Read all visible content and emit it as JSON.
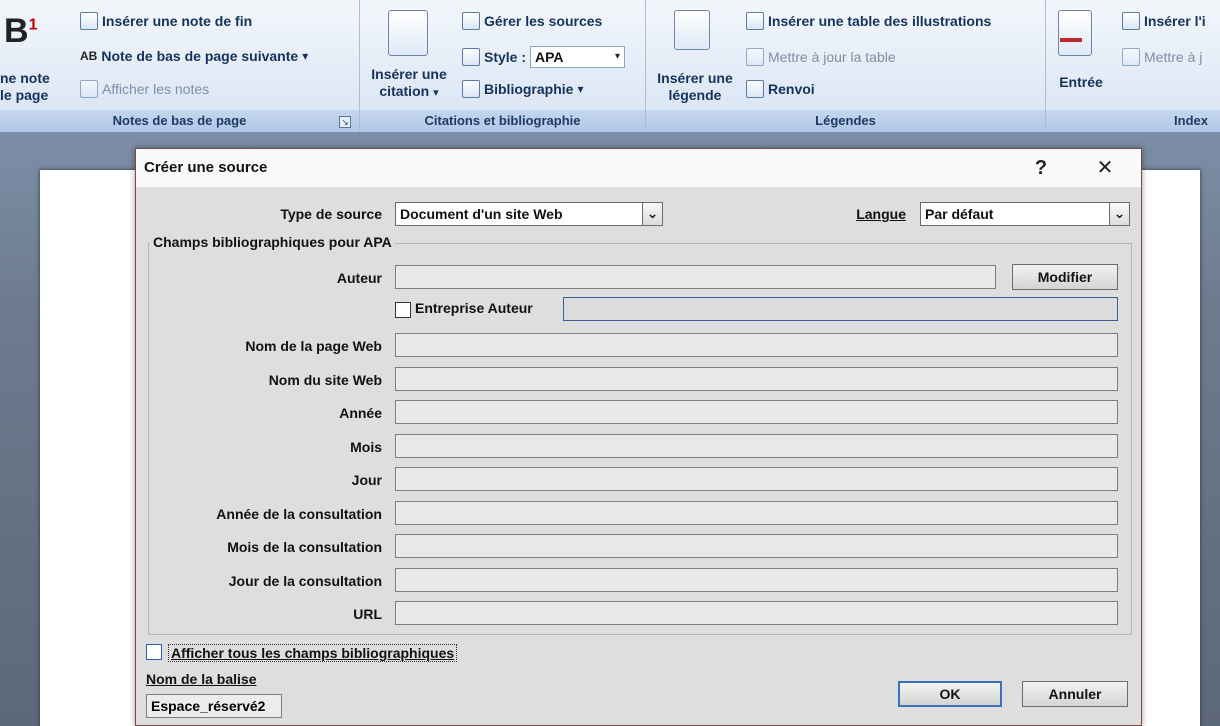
{
  "ribbon": {
    "footnotes": {
      "insert_footnote_label_1": "ne note",
      "insert_footnote_label_2": "le page",
      "insert_endnote": "Insérer une note de fin",
      "next_footnote": "Note de bas de page suivante",
      "show_notes": "Afficher les notes",
      "group_label": "Notes de bas de page",
      "ab_glyph": "AB",
      "launcher_glyph": "↘"
    },
    "citations": {
      "insert_citation_1": "Insérer une",
      "insert_citation_2": "citation",
      "manage_sources": "Gérer les sources",
      "style_label": "Style :",
      "style_value": "APA",
      "bibliography": "Bibliographie",
      "group_label": "Citations et bibliographie"
    },
    "captions": {
      "insert_caption_1": "Insérer une",
      "insert_caption_2": "légende",
      "insert_table_of_figures": "Insérer une table des illustrations",
      "update_table": "Mettre à jour la table",
      "cross_reference": "Renvoi",
      "group_label": "Légendes"
    },
    "index": {
      "mark_entry": "Entrée",
      "insert_index": "Insérer l'i",
      "update_index": "Mettre à j",
      "group_label": "Index"
    },
    "glyphs": {
      "big_b": "B",
      "superscript_1": "1",
      "dropdown_arrow": "▾"
    }
  },
  "dialog": {
    "title": "Créer une source",
    "help_glyph": "?",
    "close_glyph": "✕",
    "source_type_label": "Type de source",
    "source_type_value": "Document d'un site Web",
    "language_label": "Langue",
    "language_value": "Par défaut",
    "fields_legend": "Champs bibliographiques pour APA",
    "author_label": "Auteur",
    "edit_button": "Modifier",
    "corporate_author_label": "Entreprise Auteur",
    "fields": [
      {
        "label": "Nom de la page Web",
        "value": ""
      },
      {
        "label": "Nom du site Web",
        "value": ""
      },
      {
        "label": "Année",
        "value": ""
      },
      {
        "label": "Mois",
        "value": ""
      },
      {
        "label": "Jour",
        "value": ""
      },
      {
        "label": "Année de la consultation",
        "value": ""
      },
      {
        "label": "Mois de la consultation",
        "value": ""
      },
      {
        "label": "Jour de la consultation",
        "value": ""
      },
      {
        "label": "URL",
        "value": ""
      }
    ],
    "show_all_fields_label": "Afficher tous les champs bibliographiques",
    "tag_name_label": "Nom de la balise",
    "tag_name_value": "Espace_réservé2",
    "ok_button": "OK",
    "cancel_button": "Annuler",
    "combo_arrow": "⌄"
  },
  "colors": {
    "ribbon_text": "#15325e",
    "primary_border": "#3d6fbf",
    "checkbox_focus": "#2f5fb5"
  }
}
